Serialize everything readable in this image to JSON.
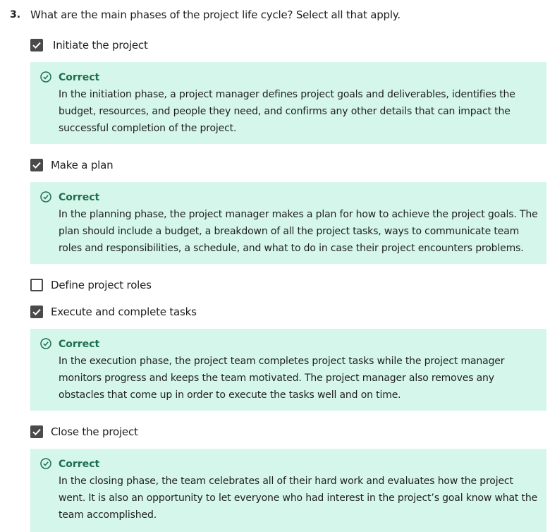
{
  "question": {
    "number": "3.",
    "text": "What are the main phases of the project life cycle? Select all that apply."
  },
  "options": [
    {
      "label": "Initiate the project",
      "checked": true,
      "feedback": {
        "status": "Correct",
        "text": "In the initiation phase, a project manager defines project goals and deliverables, identifies the budget, resources, and people they need, and confirms any other details that can impact the successful completion of the project."
      }
    },
    {
      "label": "Make a plan",
      "checked": true,
      "feedback": {
        "status": "Correct",
        "text": "In the planning phase, the project manager makes a plan for how to achieve the project goals. The plan should include a budget, a breakdown of all the project tasks, ways to communicate team roles and responsibilities, a schedule, and what to do in case their project encounters problems."
      }
    },
    {
      "label": "Define project roles",
      "checked": false
    },
    {
      "label": "Execute and complete tasks",
      "checked": true,
      "feedback": {
        "status": "Correct",
        "text": "In the execution phase, the project team completes project tasks while the project manager monitors progress and keeps the team motivated. The project manager also removes any obstacles that come up in order to execute the tasks well and on time."
      }
    },
    {
      "label": "Close the project",
      "checked": true,
      "feedback": {
        "status": "Correct",
        "text": "In the closing phase, the team celebrates all of their hard work and evaluates how the project went. It is also an opportunity to let everyone who had interest in the project’s goal know what the team accomplished."
      }
    }
  ],
  "icons": {
    "checked_box": "checkmark-icon",
    "feedback": "check-circle-icon"
  },
  "colors": {
    "feedback_background": "#d5f6ea",
    "correct_text": "#1d6f4f",
    "checkbox": "#4a4a4a"
  }
}
